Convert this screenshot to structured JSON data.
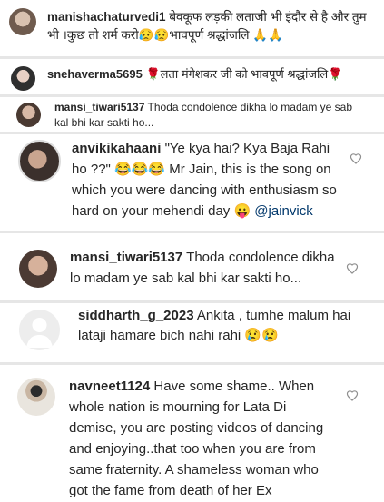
{
  "comments": [
    {
      "username": "manishachaturvedi1",
      "text": "बेवकूफ लड़की लताजी भी इंदौर से है और तुम भी ।कुछ तो शर्म करो😥😥भावपूर्ण श्रद्धांजलि 🙏🙏",
      "avatar_icon": "avatar-photo"
    },
    {
      "username": "snehaverma5695",
      "text": "🌹लता मंगेशकर जी को भावपूर्ण श्रद्धांजलि🌹",
      "avatar_icon": "avatar-photo"
    },
    {
      "username": "mansi_tiwari5137",
      "text": "Thoda condolence dikha lo madam ye sab kal bhi kar sakti ho...",
      "avatar_icon": "avatar-photo"
    },
    {
      "username": "anvikikahaani",
      "text": "\"Ye kya hai? Kya Baja Rahi ho ??\" 😂😂😂 Mr Jain, this is the song on which you were dancing with enthusiasm so hard on your mehendi day 😛",
      "mention": "@jainvick",
      "avatar_icon": "avatar-photo"
    },
    {
      "username": "mansi_tiwari5137",
      "text": "Thoda condolence dikha lo madam ye sab kal bhi kar sakti ho...",
      "avatar_icon": "avatar-photo"
    },
    {
      "username": "siddharth_g_2023",
      "text": "Ankita , tumhe malum hai lataji hamare bich nahi rahi 😢😢",
      "avatar_icon": "default-avatar-icon"
    },
    {
      "username": "navneet1124",
      "text": "Have some shame.. When whole nation is mourning for Lata Di demise, you are posting videos of dancing and enjoying..that too when you are from same fraternity. A shameless woman who got the fame from death of her Ex Boyfriend..",
      "avatar_icon": "avatar-photo"
    }
  ],
  "icons": {
    "like": "heart-outline-icon"
  },
  "colors": {
    "text": "#262626",
    "mention": "#00376b",
    "separator": "#e6e6e6",
    "heart": "#8e8e8e"
  }
}
